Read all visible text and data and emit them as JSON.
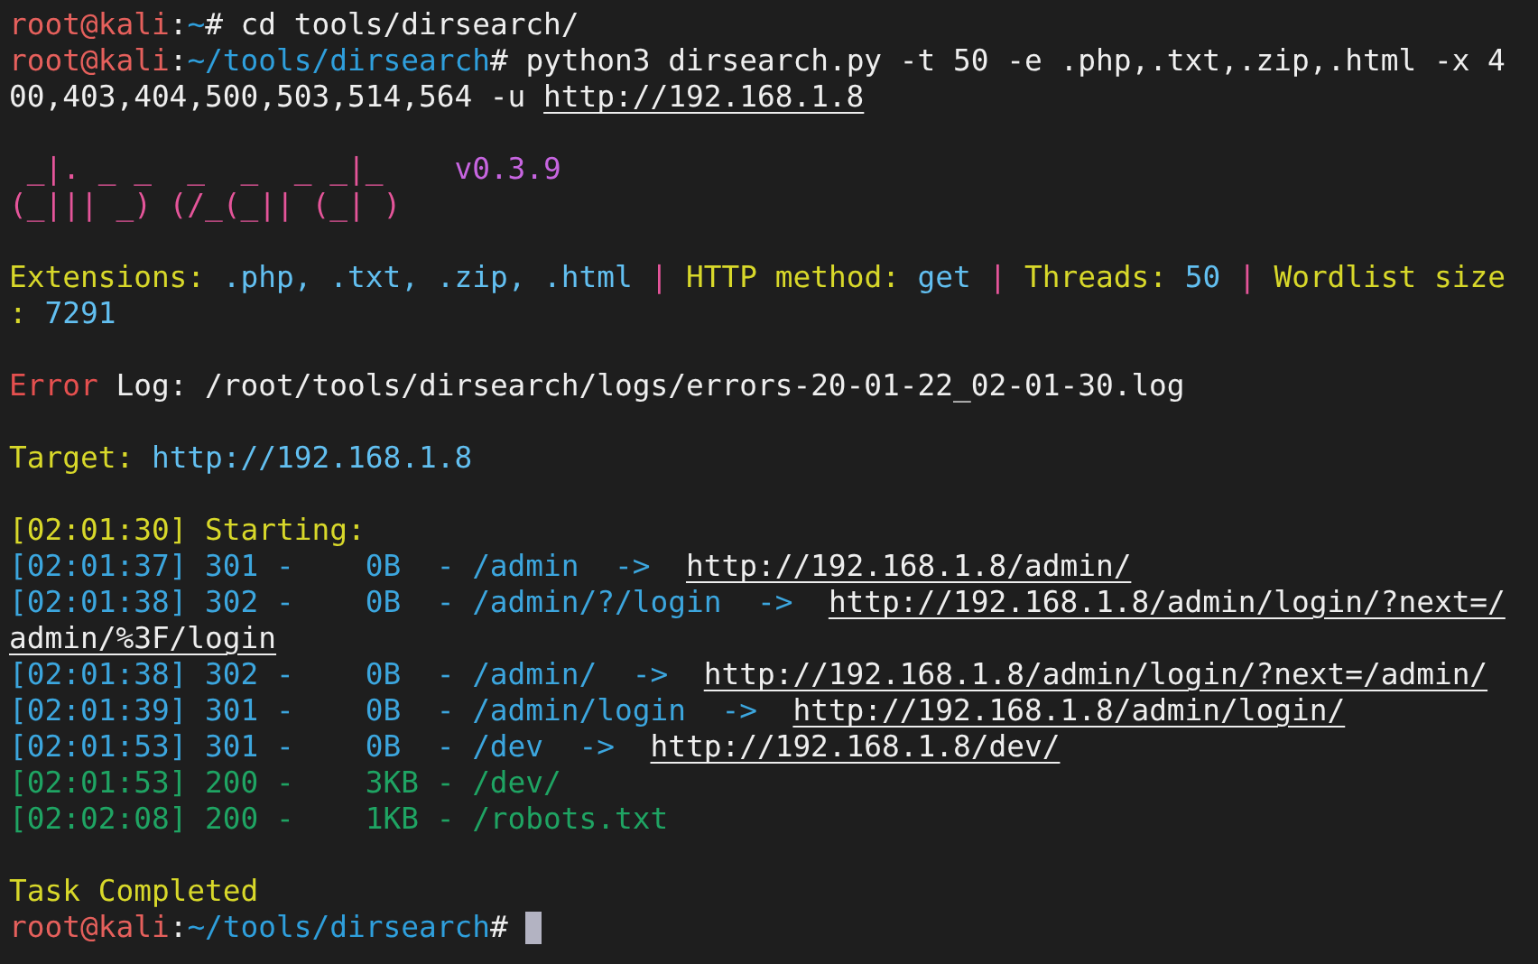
{
  "terminal": {
    "lines": [
      {
        "kind": "text",
        "segments": [
          {
            "text": "root@kali",
            "kind": "user"
          },
          {
            "text": ":",
            "kind": "plain"
          },
          {
            "text": "~",
            "kind": "path"
          },
          {
            "text": "# cd tools/dirsearch/",
            "kind": "cmd"
          }
        ]
      },
      {
        "kind": "text",
        "segments": [
          {
            "text": "root@kali",
            "kind": "user"
          },
          {
            "text": ":",
            "kind": "plain"
          },
          {
            "text": "~/tools/dirsearch",
            "kind": "path"
          },
          {
            "text": "# python3 dirsearch.py -t 50 -e .php,.txt,.zip,.html -x 4",
            "kind": "cmd"
          }
        ]
      },
      {
        "kind": "text",
        "segments": [
          {
            "text": "00,403,404,500,503,514,564 -u ",
            "kind": "cmd"
          },
          {
            "text": "http://192.168.1.8",
            "kind": "link"
          }
        ]
      },
      {
        "kind": "blank"
      },
      {
        "kind": "text",
        "segments": [
          {
            "text": " _|. _ _  _  _  _ _|_",
            "kind": "art"
          },
          {
            "text": "v0.3.9",
            "kind": "version"
          }
        ]
      },
      {
        "kind": "text",
        "segments": [
          {
            "text": "(_||| _) (/_(_|| (_| )",
            "kind": "art"
          }
        ]
      },
      {
        "kind": "blank"
      },
      {
        "kind": "text",
        "segments": [
          {
            "text": "Extensions:",
            "kind": "label"
          },
          {
            "text": " .php, .txt, .zip, .html",
            "kind": "value"
          },
          {
            "text": " | ",
            "kind": "sep"
          },
          {
            "text": "HTTP method:",
            "kind": "label"
          },
          {
            "text": " get",
            "kind": "value"
          },
          {
            "text": " | ",
            "kind": "sep"
          },
          {
            "text": "Threads:",
            "kind": "label"
          },
          {
            "text": " 50",
            "kind": "value"
          },
          {
            "text": " | ",
            "kind": "sep"
          },
          {
            "text": "Wordlist size",
            "kind": "label"
          }
        ]
      },
      {
        "kind": "text",
        "segments": [
          {
            "text": ": ",
            "kind": "label"
          },
          {
            "text": "7291",
            "kind": "value"
          }
        ]
      },
      {
        "kind": "blank"
      },
      {
        "kind": "text",
        "segments": [
          {
            "text": "Error",
            "kind": "error"
          },
          {
            "text": " Log: /root/tools/dirsearch/logs/errors-20-01-22_02-01-30.log",
            "kind": "cmd"
          }
        ]
      },
      {
        "kind": "blank"
      },
      {
        "kind": "text",
        "segments": [
          {
            "text": "Target:",
            "kind": "label"
          },
          {
            "text": " http://192.168.1.8",
            "kind": "value"
          }
        ]
      },
      {
        "kind": "blank"
      },
      {
        "kind": "text",
        "segments": [
          {
            "text": "[02:01:30] Starting:",
            "kind": "label"
          }
        ]
      },
      {
        "kind": "text",
        "segments": [
          {
            "text": "[02:01:37] 301 -    0B  - /admin  ->  ",
            "kind": "redirect"
          },
          {
            "text": "http://192.168.1.8/admin/",
            "kind": "link"
          }
        ]
      },
      {
        "kind": "text",
        "segments": [
          {
            "text": "[02:01:38] 302 -    0B  - /admin/?/login  ->  ",
            "kind": "redirect"
          },
          {
            "text": "http://192.168.1.8/admin/login/?next=/",
            "kind": "link"
          }
        ]
      },
      {
        "kind": "text",
        "segments": [
          {
            "text": "admin/%3F/login",
            "kind": "link"
          }
        ]
      },
      {
        "kind": "text",
        "segments": [
          {
            "text": "[02:01:38] 302 -    0B  - /admin/  ->  ",
            "kind": "redirect"
          },
          {
            "text": "http://192.168.1.8/admin/login/?next=/admin/",
            "kind": "link"
          }
        ]
      },
      {
        "kind": "text",
        "segments": [
          {
            "text": "[02:01:39] 301 -    0B  - /admin/login  ->  ",
            "kind": "redirect"
          },
          {
            "text": "http://192.168.1.8/admin/login/",
            "kind": "link"
          }
        ]
      },
      {
        "kind": "text",
        "segments": [
          {
            "text": "[02:01:53] 301 -    0B  - /dev  ->  ",
            "kind": "redirect"
          },
          {
            "text": "http://192.168.1.8/dev/",
            "kind": "link"
          }
        ]
      },
      {
        "kind": "text",
        "segments": [
          {
            "text": "[02:01:53] 200 -    3KB - /dev/",
            "kind": "success"
          }
        ]
      },
      {
        "kind": "text",
        "segments": [
          {
            "text": "[02:02:08] 200 -    1KB - /robots.txt",
            "kind": "success"
          }
        ]
      },
      {
        "kind": "blank"
      },
      {
        "kind": "text",
        "segments": [
          {
            "text": "Task Completed",
            "kind": "label"
          }
        ]
      },
      {
        "kind": "text",
        "cursor": true,
        "segments": [
          {
            "text": "root@kali",
            "kind": "user"
          },
          {
            "text": ":",
            "kind": "plain"
          },
          {
            "text": "~/tools/dirsearch",
            "kind": "path"
          },
          {
            "text": "# ",
            "kind": "cmd"
          }
        ]
      }
    ]
  }
}
